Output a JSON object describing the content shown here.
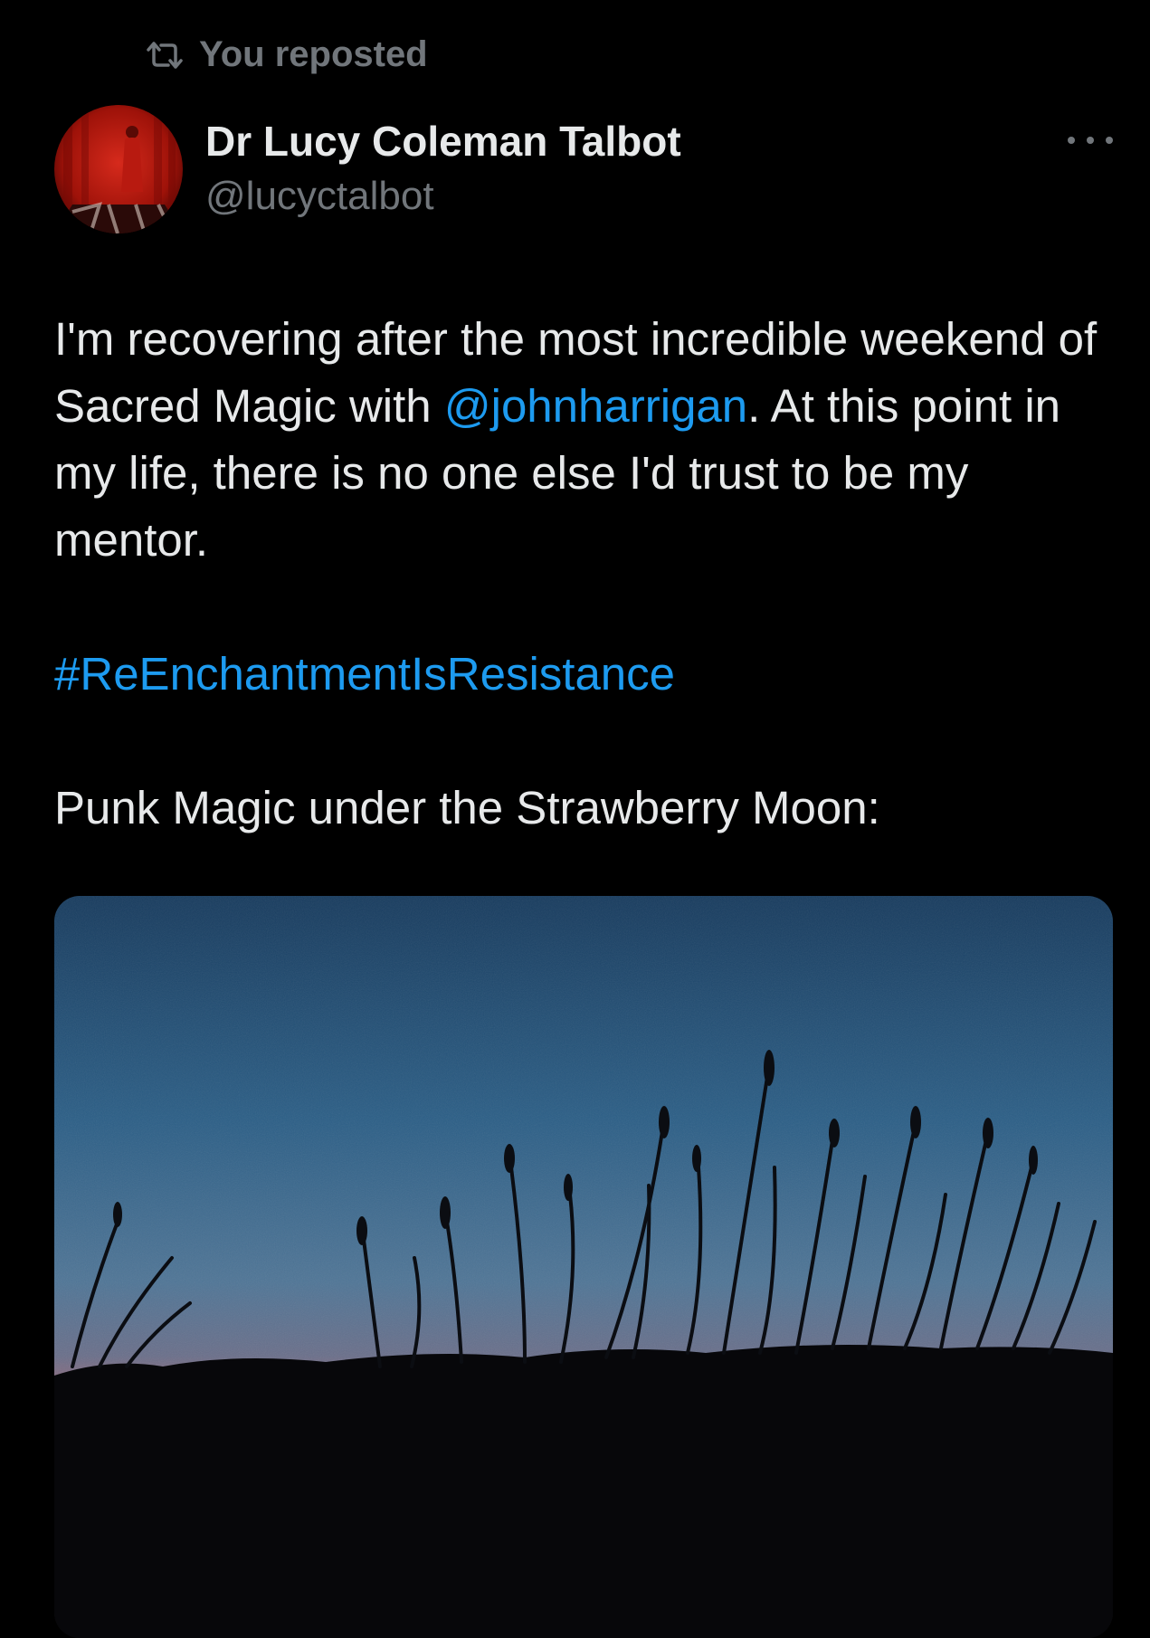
{
  "repost": {
    "icon": "repost-icon",
    "label": "You reposted"
  },
  "author": {
    "avatar_icon": "avatar",
    "display_name": "Dr Lucy Coleman Talbot",
    "handle": "@lucyctalbot"
  },
  "more_menu": {
    "icon": "more-options-icon"
  },
  "tweet": {
    "text_part1": "I'm recovering after the most incredible weekend of Sacred Magic with ",
    "mention": "@johnharrigan",
    "text_part2": ". At this point in my life, there is no one else I'd trust to be my mentor.",
    "hashtag": "#ReEnchantmentIsResistance",
    "text_part3": "Punk Magic under the Strawberry Moon:"
  },
  "colors": {
    "background": "#000000",
    "primary_text": "#e7e9ea",
    "secondary_text": "#71767b",
    "link": "#1d9bf0"
  }
}
